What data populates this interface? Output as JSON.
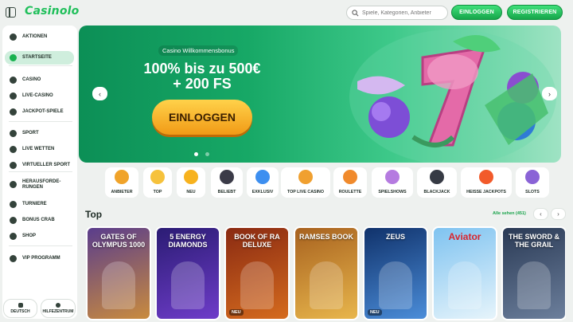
{
  "header": {
    "logo": "Casinolo",
    "search_placeholder": "Spiele, Kategorien, Anbieter",
    "login": "EINLOGGEN",
    "register": "REGISTRIEREN"
  },
  "sidebar": {
    "items": [
      {
        "label": "AKTIONEN",
        "icon": "gift-icon"
      },
      {
        "label": "STARTSEITE",
        "icon": "home-icon",
        "active": true
      },
      {
        "label": "CASINO",
        "icon": "casino-chip-icon"
      },
      {
        "label": "LIVE-CASINO",
        "icon": "live-casino-icon"
      },
      {
        "label": "JACKPOT-SPIELE",
        "icon": "jackpot-icon"
      },
      {
        "label": "SPORT",
        "icon": "soccer-ball-icon"
      },
      {
        "label": "LIVE WETTEN",
        "icon": "live-bets-icon"
      },
      {
        "label": "VIRTUELLER SPORT",
        "icon": "virtual-sport-icon"
      },
      {
        "label": "HERAUSFORDE-RUNGEN",
        "icon": "challenge-icon"
      },
      {
        "label": "TURNIERE",
        "icon": "trophy-icon"
      },
      {
        "label": "BONUS CRAB",
        "icon": "bonus-crab-icon"
      },
      {
        "label": "SHOP",
        "icon": "shop-icon"
      },
      {
        "label": "VIP PROGRAMM",
        "icon": "crown-icon"
      }
    ],
    "footer": {
      "language": "DEUTSCH",
      "help": "HILFEZENTRUM"
    }
  },
  "hero": {
    "badge": "Casino Willkommensbonus",
    "title_line1": "100% bis zu 500€",
    "title_line2": "+ 200 FS",
    "cta": "EINLOGGEN",
    "slides": 2,
    "active_slide": 1
  },
  "categories": [
    {
      "label": "ANBIETER",
      "color": "#f0a32a"
    },
    {
      "label": "TOP",
      "color": "#f6c23c"
    },
    {
      "label": "NEU",
      "color": "#f7b21e"
    },
    {
      "label": "BELIEBT",
      "color": "#3b3b48"
    },
    {
      "label": "EXKLUSIV",
      "color": "#3d8ff0"
    },
    {
      "label": "TOP LIVE CASINO",
      "color": "#f0a030"
    },
    {
      "label": "ROULETTE",
      "color": "#f08a2c"
    },
    {
      "label": "SPIELSHOWS",
      "color": "#b57be0"
    },
    {
      "label": "BLACKJACK",
      "color": "#363a44"
    },
    {
      "label": "HEISSE JACKPOTS",
      "color": "#f25a2a"
    },
    {
      "label": "SLOTS",
      "color": "#8a63d6"
    }
  ],
  "top_section": {
    "title": "Top",
    "see_all": "Alle sehen (451)"
  },
  "games": [
    {
      "title": "GATES OF OLYMPUS 1000",
      "bg1": "#5a3d8c",
      "bg2": "#c98b3e",
      "new": false
    },
    {
      "title": "5 ENERGY DIAMONDS",
      "bg1": "#2b1c74",
      "bg2": "#6e3cc9",
      "new": false
    },
    {
      "title": "BOOK OF RA DELUXE",
      "bg1": "#8a2a12",
      "bg2": "#d56b1e",
      "new": true
    },
    {
      "title": "RAMSES BOOK",
      "bg1": "#a8621f",
      "bg2": "#e8b64c",
      "new": false
    },
    {
      "title": "ZEUS",
      "bg1": "#10326b",
      "bg2": "#4b8dd9",
      "new": true
    },
    {
      "title": "Aviator",
      "bg1": "#7fc3f0",
      "bg2": "#e6f4fb",
      "new": false
    },
    {
      "title": "THE SWORD & THE GRAIL",
      "bg1": "#2a3a55",
      "bg2": "#6c7f9c",
      "new": false
    }
  ],
  "new_badge": "NEU"
}
